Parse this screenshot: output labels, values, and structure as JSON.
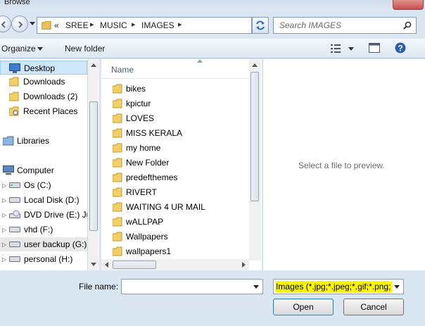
{
  "window": {
    "title": "Browse"
  },
  "address": {
    "chevrons": "«",
    "crumbs": [
      "SREE",
      "MUSIC",
      "IMAGES"
    ]
  },
  "search": {
    "placeholder": "Search IMAGES"
  },
  "toolbar": {
    "organize_label": "Organize",
    "new_folder_label": "New folder"
  },
  "navigation": {
    "items": [
      {
        "label": "Desktop",
        "icon": "desktop-icon",
        "selected": true
      },
      {
        "label": "Downloads",
        "icon": "folder-icon"
      },
      {
        "label": "Downloads (2)",
        "icon": "folder-icon"
      },
      {
        "label": "Recent Places",
        "icon": "recent-places-icon"
      },
      {
        "label": "Libraries",
        "icon": "libraries-icon"
      },
      {
        "label": "Computer",
        "icon": "computer-icon"
      },
      {
        "label": "Os (C:)",
        "icon": "drive-icon"
      },
      {
        "label": "Local Disk (D:)",
        "icon": "drive-icon"
      },
      {
        "label": "DVD Drive (E:) Jul",
        "icon": "dvd-drive-icon"
      },
      {
        "label": "vhd (F:)",
        "icon": "drive-icon"
      },
      {
        "label": "user backup (G:)",
        "icon": "drive-icon"
      },
      {
        "label": "personal (H:)",
        "icon": "drive-icon"
      }
    ]
  },
  "file_list": {
    "column_name": "Name",
    "folders": [
      "bikes",
      "kpictur",
      "LOVES",
      "MISS KERALA",
      "my home",
      "New Folder",
      "predefthemes",
      "RIVERT",
      "WAITING 4 UR MAIL",
      "wALLPAP",
      "Wallpapers",
      "wallpapers1"
    ]
  },
  "preview": {
    "message": "Select a file to preview."
  },
  "footer": {
    "file_name_label": "File name:",
    "file_name_value": "",
    "filter_label": "Images (*.jpg;*.jpeg;*.gif;*.png;",
    "open_label": "Open",
    "cancel_label": "Cancel"
  },
  "colors": {
    "accent": "#3c7fb1",
    "selection": "#cde6fb",
    "filter_highlight": "#fff700"
  }
}
